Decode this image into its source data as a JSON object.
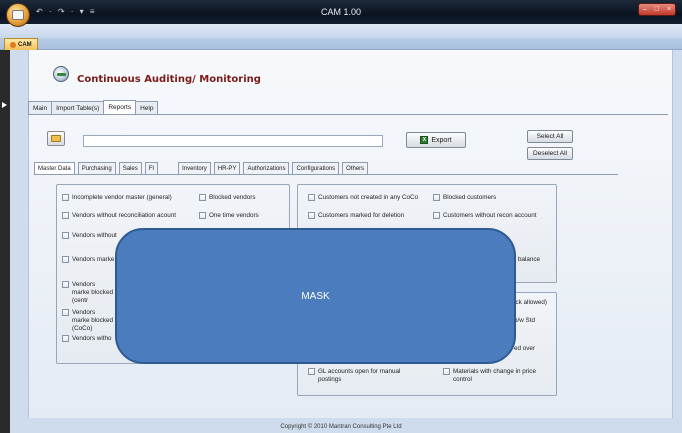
{
  "window": {
    "title": "CAM 1.00",
    "quick_access": "↶ · ↷ · ▾  ≡"
  },
  "ribbon": {
    "tab_label": "CAM"
  },
  "app": {
    "title": "Continuous Auditing/ Monitoring"
  },
  "main_tabs": [
    "Main",
    "Import Table(s)",
    "Reports",
    "Help"
  ],
  "toolbar": {
    "path_value": "",
    "export_label": "Export",
    "select_all_label": "Select All",
    "deselect_all_label": "Deselect All"
  },
  "sub_tabs": [
    "Master Data",
    "Purchasing",
    "Sales",
    "FI",
    "Inventory",
    "HR-PY",
    "Authorizations",
    "Configurations",
    "Others"
  ],
  "vendor_group": {
    "col1": [
      "Incomplete vendor master (general)",
      "Vendors without reconciliation acount",
      "Vendors without",
      "Vendors marke",
      "Vendors marke blocked (centr",
      "Vendors marke blocked (CoCo)",
      "Vendors witho"
    ],
    "col2": [
      "Blocked vendors",
      "One time vendors"
    ]
  },
  "customer_group": {
    "col1": [
      "Customers not created in any CoCo",
      "Customers marked for deletion"
    ],
    "col2": [
      "Blocked customers",
      "Customers without recon account"
    ],
    "fragments": [
      "balance"
    ]
  },
  "bottom_group": {
    "col1": [
      "GL accounts open for manual postings"
    ],
    "col2": [
      "Materials with change in price control"
    ],
    "fragments": [
      "ock allowed)",
      "b/w Std",
      "ed over"
    ]
  },
  "mask_label": "MASK",
  "footer": "Copyright © 2010 Mantran Consulting Pte Ltd"
}
